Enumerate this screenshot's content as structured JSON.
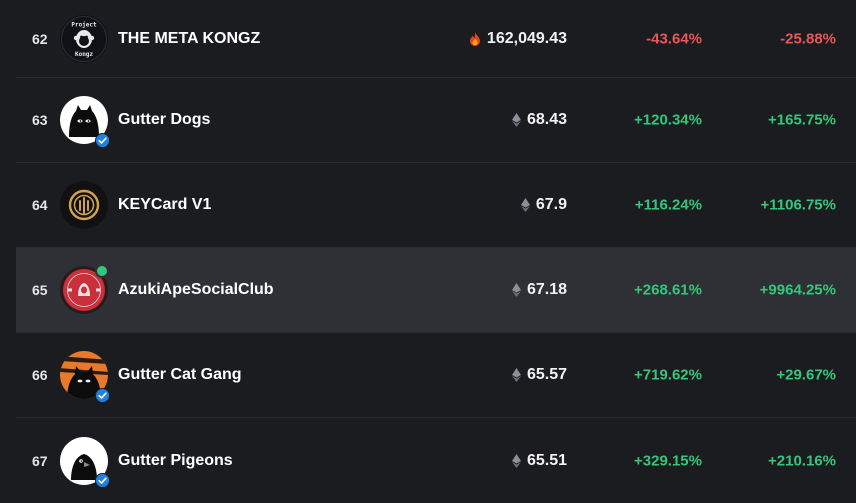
{
  "colors": {
    "positive": "#34c77b",
    "negative": "#eb5757",
    "verified": "#2081e2",
    "online": "#34c77b"
  },
  "rows": [
    {
      "rank": "62",
      "name": "THE META KONGZ",
      "price": "162,049.43",
      "currency_icon": "token-fire-icon",
      "change_1": "-43.64%",
      "change_2": "-25.88%",
      "avatar_text_top": "Project",
      "avatar_text_bottom": "Kongz",
      "verified": false
    },
    {
      "rank": "63",
      "name": "Gutter Dogs",
      "price": "68.43",
      "currency_icon": "ethereum-icon",
      "change_1": "+120.34%",
      "change_2": "+165.75%",
      "verified": true
    },
    {
      "rank": "64",
      "name": "KEYCard V1",
      "price": "67.9",
      "currency_icon": "ethereum-icon",
      "change_1": "+116.24%",
      "change_2": "+1106.75%",
      "verified": false
    },
    {
      "rank": "65",
      "name": "AzukiApeSocialClub",
      "price": "67.18",
      "currency_icon": "ethereum-icon",
      "change_1": "+268.61%",
      "change_2": "+9964.25%",
      "verified": false,
      "online": true
    },
    {
      "rank": "66",
      "name": "Gutter Cat Gang",
      "price": "65.57",
      "currency_icon": "ethereum-icon",
      "change_1": "+719.62%",
      "change_2": "+29.67%",
      "verified": true
    },
    {
      "rank": "67",
      "name": "Gutter Pigeons",
      "price": "65.51",
      "currency_icon": "ethereum-icon",
      "change_1": "+329.15%",
      "change_2": "+210.16%",
      "verified": true
    }
  ]
}
